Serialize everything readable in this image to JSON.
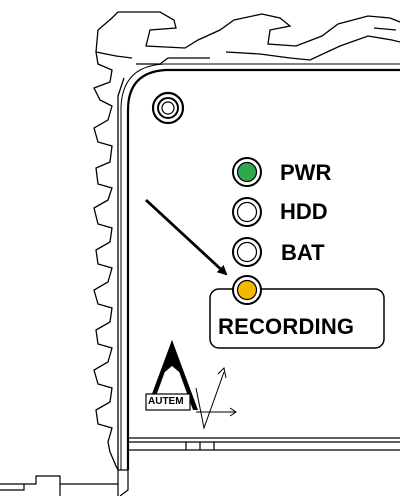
{
  "indicators": [
    {
      "label": "PWR",
      "color": "#2fa84f",
      "state": "on"
    },
    {
      "label": "HDD",
      "color": "#ffffff",
      "state": "off"
    },
    {
      "label": "BAT",
      "color": "#ffffff",
      "state": "off"
    },
    {
      "label": "RECORDING",
      "color": "#f5b800",
      "state": "on"
    }
  ],
  "brand": {
    "name": "AUTEM"
  },
  "colors": {
    "outline": "#000000",
    "background": "#ffffff",
    "shade": "#e8e8e8"
  }
}
